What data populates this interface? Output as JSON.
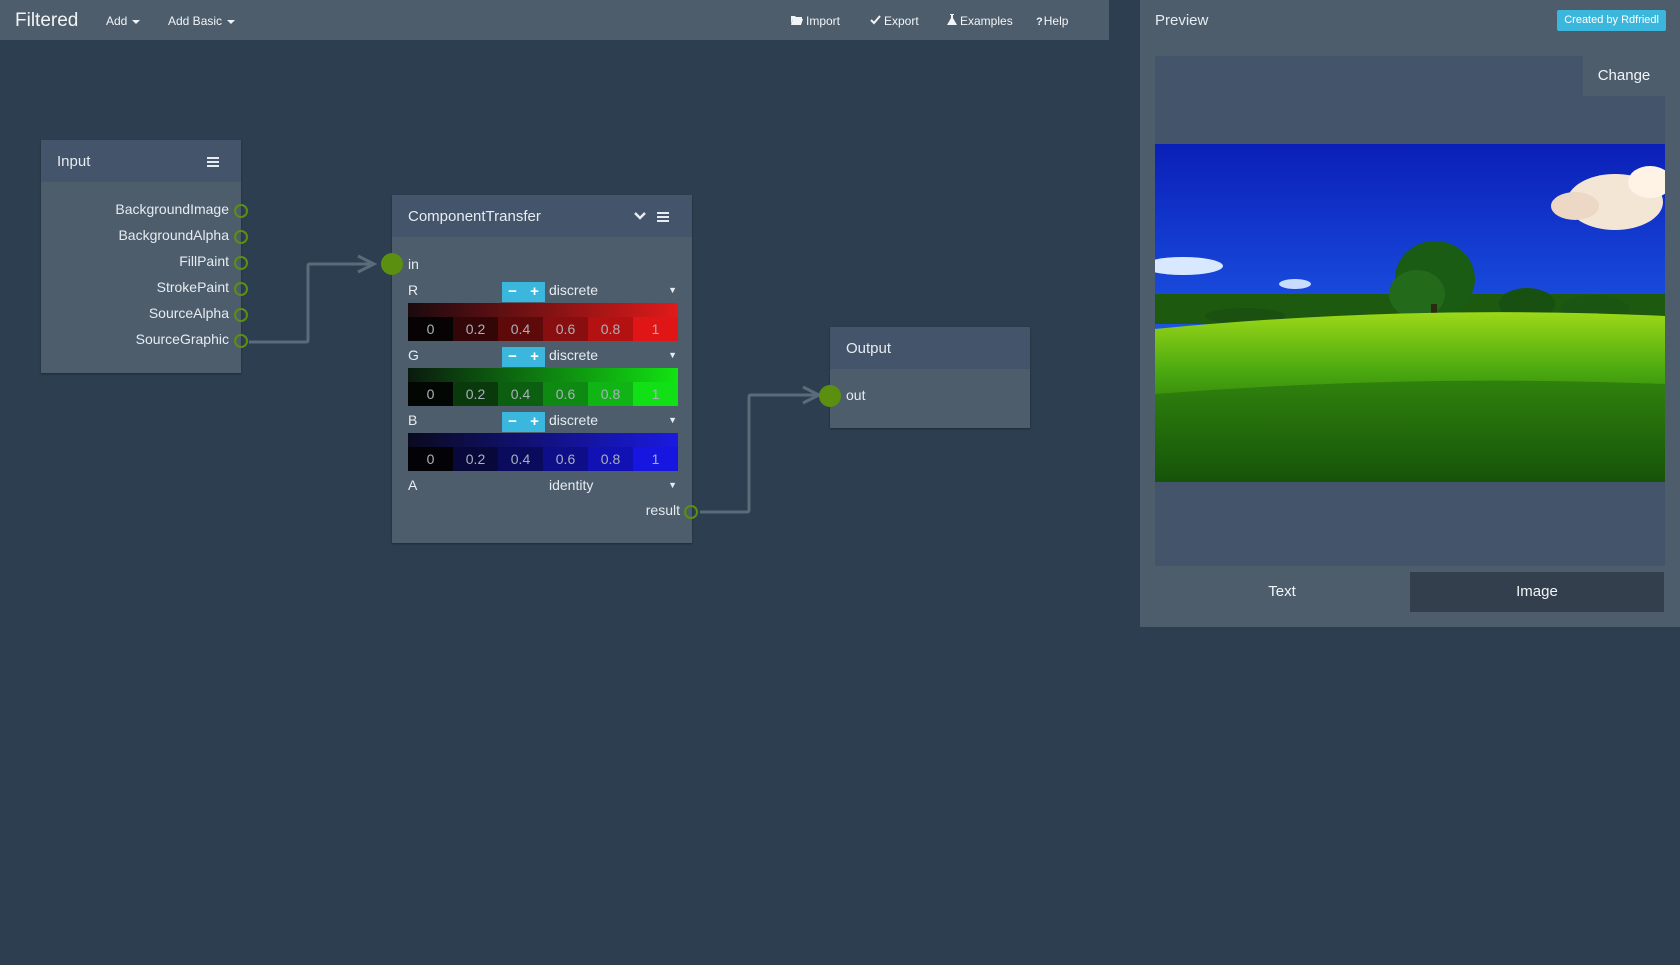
{
  "app": {
    "title": "Filtered",
    "menu": {
      "add": "Add",
      "add_basic": "Add Basic",
      "import": "Import",
      "export": "Export",
      "examples": "Examples",
      "help": "Help"
    }
  },
  "preview": {
    "title": "Preview",
    "credit": "Created by Rdfriedl",
    "change_button": "Change",
    "tabs": [
      "Text",
      "Image"
    ],
    "active_tab": "Image"
  },
  "nodes": {
    "input": {
      "title": "Input",
      "outputs": [
        "BackgroundImage",
        "BackgroundAlpha",
        "FillPaint",
        "StrokePaint",
        "SourceAlpha",
        "SourceGraphic"
      ]
    },
    "component_transfer": {
      "title": "ComponentTransfer",
      "input_port": "in",
      "output_port": "result",
      "channels": [
        {
          "label": "R",
          "mode": "discrete",
          "values": [
            "0",
            "0.2",
            "0.4",
            "0.6",
            "0.8",
            "1"
          ],
          "color": "#e11a1a"
        },
        {
          "label": "G",
          "mode": "discrete",
          "values": [
            "0",
            "0.2",
            "0.4",
            "0.6",
            "0.8",
            "1"
          ],
          "color": "#12e312"
        },
        {
          "label": "B",
          "mode": "discrete",
          "values": [
            "0",
            "0.2",
            "0.4",
            "0.6",
            "0.8",
            "1"
          ],
          "color": "#1a1ae1"
        },
        {
          "label": "A",
          "mode": "identity"
        }
      ]
    },
    "output": {
      "title": "Output",
      "input_port": "out"
    }
  },
  "colors": {
    "canvas": "#2d3e50",
    "panel": "#4d5d6c",
    "node_header": "#44546a",
    "port": "#5a8f10",
    "accent": "#3bb7dd"
  }
}
